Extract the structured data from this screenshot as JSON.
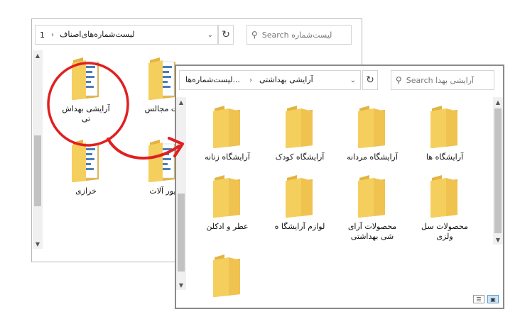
{
  "back_window": {
    "address": "لیست‌شماره‌های‌اصناف",
    "address_trailing": "1",
    "search_placeholder": "Search لیست‌شماره",
    "folders": [
      {
        "label": "آرایشی بهداش تی"
      },
      {
        "label": "ات مجالس"
      },
      {
        "label": "خرازی"
      },
      {
        "label": "یور آلات"
      }
    ]
  },
  "front_window": {
    "address_root": "...لیست‌شماره‌ها",
    "address_current": "آرایشی بهداشتی",
    "search_placeholder": "Search آرایشی بهدا",
    "folders": [
      {
        "label": "آرایشگاه ها"
      },
      {
        "label": "آرایشگاه مردانه"
      },
      {
        "label": "آرایشگاه کودک"
      },
      {
        "label": "آرایشگاه زنانه"
      },
      {
        "label": "محصولات سل ولزی"
      },
      {
        "label": "محصولات آرای شی بهداشتی"
      },
      {
        "label": "لوازم آرایشگا ه"
      },
      {
        "label": "عطر و ادکلن"
      },
      {
        "label": ""
      }
    ]
  },
  "colors": {
    "annotation": "#e02020",
    "folder_front": "#f5cf5e",
    "folder_back": "#e3b443"
  }
}
